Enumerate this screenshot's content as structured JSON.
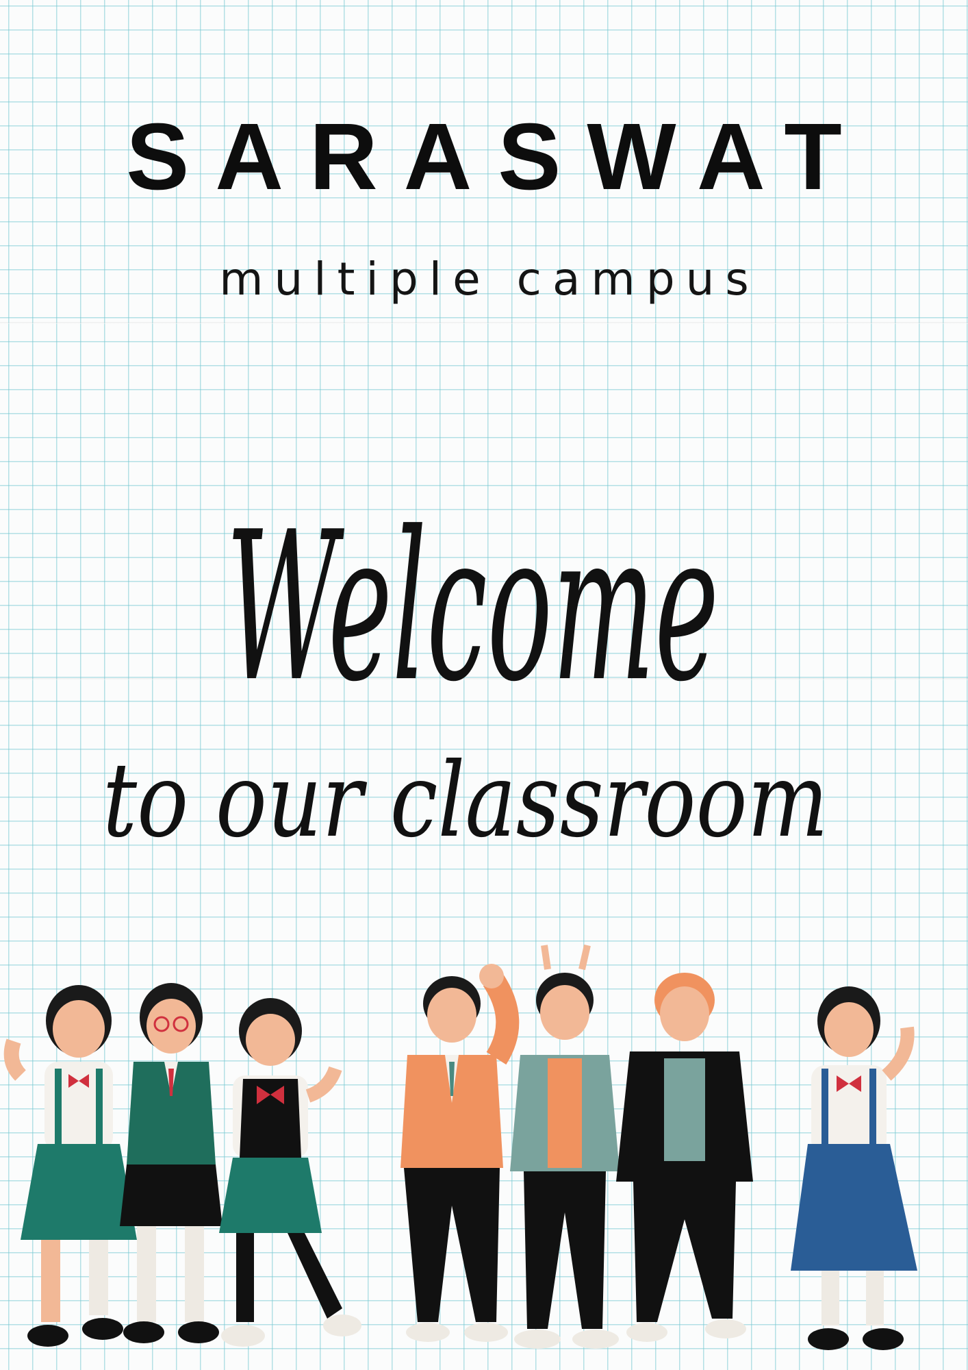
{
  "poster": {
    "title": "SARASWAT",
    "subtitle": "multiple campus",
    "welcome": "Welcome",
    "tagline": "to our classroom"
  },
  "colors": {
    "text": "#0d0d0d",
    "grid": "#8fd0d8",
    "paper": "#fbfcfc",
    "teal_uniform": "#1e7a6a",
    "orange_cardigan": "#f0925f",
    "navy_skirt": "#2a5d96",
    "red_bow": "#d0303e"
  },
  "illustration": {
    "icon": "students-group-illustration"
  }
}
